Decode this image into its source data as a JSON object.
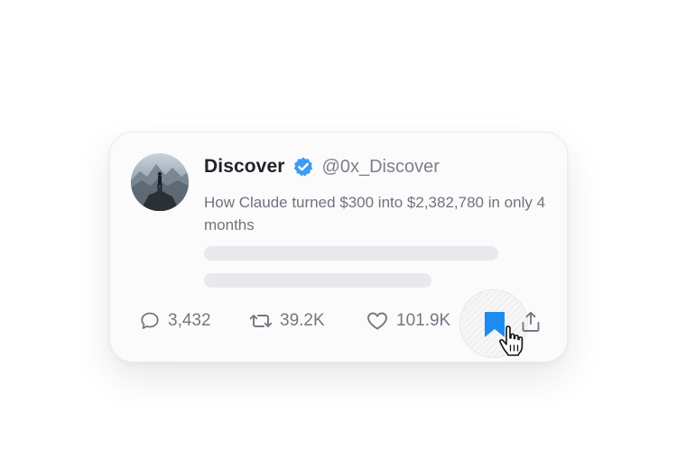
{
  "tweet": {
    "display_name": "Discover",
    "handle": "@0x_Discover",
    "text": "How Claude turned $300 into $2,382,780 in only 4 months",
    "verified": true
  },
  "actions": {
    "replies": "3,432",
    "retweets": "39.2K",
    "likes": "101.9K"
  },
  "icons": {
    "reply": "comment-icon",
    "retweet": "retweet-icon",
    "like": "heart-icon",
    "bookmark": "bookmark-icon",
    "share": "share-icon",
    "verified": "verified-badge-icon",
    "cursor": "hand-pointer-cursor-icon"
  },
  "colors": {
    "accent": "#1d8cf0",
    "verified": "#3b9cf4",
    "icon_gray": "#737882",
    "name": "#1f2329"
  }
}
